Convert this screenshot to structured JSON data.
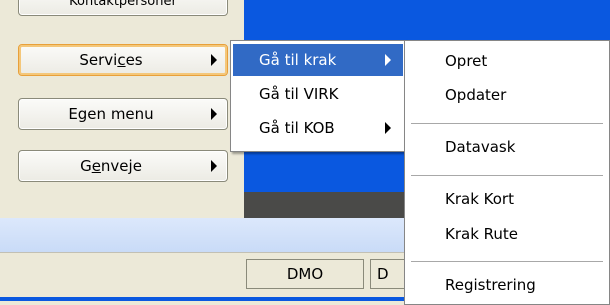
{
  "colors": {
    "menu_highlight": "#316ac5",
    "window_blue": "#0a58e0",
    "status_bar": "#d6e4fb"
  },
  "left_buttons": {
    "top_partial_label": "Kontaktpersoner",
    "services": {
      "label_pre": "Servi",
      "label_ul": "c",
      "label_post": "es",
      "arrow": "chevron-right-icon"
    },
    "egen_menu": {
      "label": "Egen menu",
      "arrow": "chevron-right-icon"
    },
    "genveje": {
      "label_pre": "G",
      "label_ul": "e",
      "label_post": "nveje",
      "arrow": "chevron-right-icon"
    }
  },
  "submenu": {
    "items": [
      {
        "label": "Gå til krak",
        "has_arrow": true,
        "active": true
      },
      {
        "label": "Gå til VIRK",
        "has_arrow": false
      },
      {
        "label": "Gå til KOB",
        "has_arrow": true
      }
    ]
  },
  "submenu2": {
    "items": [
      "Opret",
      "Opdater",
      "Datavask",
      "Krak Kort",
      "Krak Rute",
      "Registrering"
    ]
  },
  "status_bar": {
    "cell1": "DMO",
    "cell2": "D"
  }
}
